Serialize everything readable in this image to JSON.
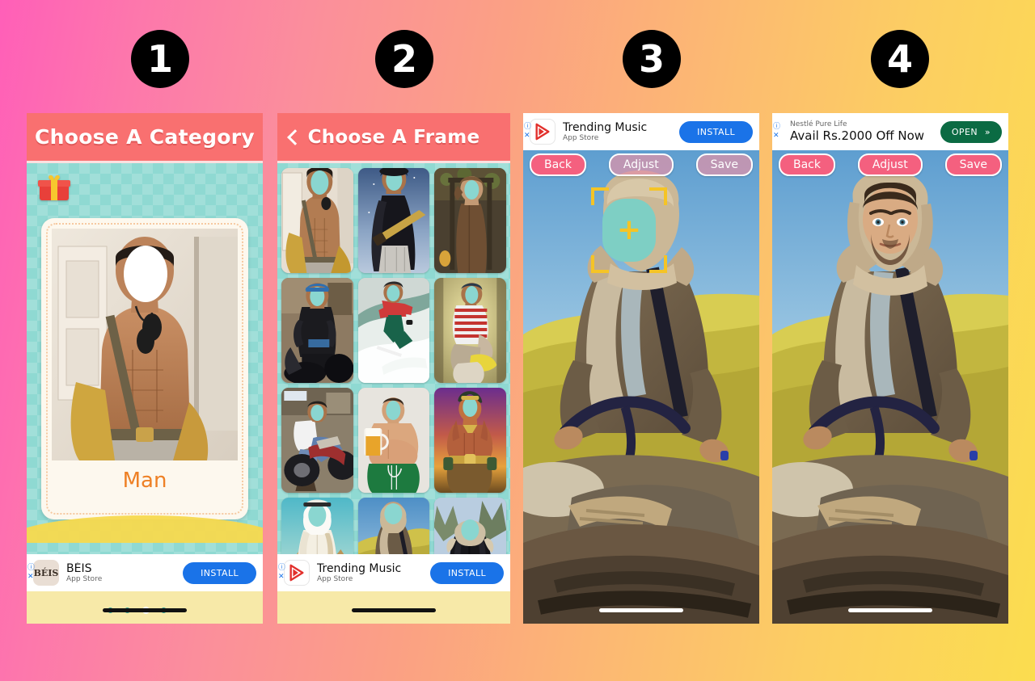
{
  "steps": [
    {
      "number": "1"
    },
    {
      "number": "2"
    },
    {
      "number": "3"
    },
    {
      "number": "4"
    }
  ],
  "colors": {
    "background_start": "#ff5fb8",
    "background_end": "#fbdd4f",
    "appbar": "#f97070",
    "teal": "#8fd9d2",
    "pill": "#f4607f",
    "accent_orange": "#ee8025",
    "install_blue": "#1a73e8",
    "open_green": "#0b6b43",
    "badge_black": "#000000",
    "face_placeholder": "#7ecfc4",
    "bracket_yellow": "#f5c426"
  },
  "screen1": {
    "title": "Choose A Category",
    "gift_icon": "gift-icon",
    "category_label": "Man",
    "pager": {
      "count": 5,
      "active_index": 2
    },
    "ad": {
      "icon_text": "BÉIS",
      "title": "BÉIS",
      "subtitle": "App Store",
      "cta": "INSTALL",
      "info_mark": "ⓘ",
      "close_mark": "✕"
    }
  },
  "screen2": {
    "title": "Choose A Frame",
    "back_icon": "chevron-left-icon",
    "frames": [
      {
        "name": "shirtless-model-frame"
      },
      {
        "name": "rockstar-guitarist-frame"
      },
      {
        "name": "monk-robe-frame"
      },
      {
        "name": "biker-leather-frame"
      },
      {
        "name": "surfer-wave-frame"
      },
      {
        "name": "sailor-striped-frame"
      },
      {
        "name": "motorcycle-rider-frame"
      },
      {
        "name": "beer-belly-frame"
      },
      {
        "name": "barbarian-warrior-frame"
      },
      {
        "name": "arab-thobe-frame"
      },
      {
        "name": "desert-camel-rider-frame"
      },
      {
        "name": "winter-fur-jacket-frame"
      }
    ],
    "ad": {
      "icon_text": "play-store-icon",
      "title": "Trending Music",
      "subtitle": "App Store",
      "cta": "INSTALL",
      "info_mark": "ⓘ",
      "close_mark": "✕"
    }
  },
  "screen3": {
    "buttons": {
      "back": "Back",
      "adjust": "Adjust",
      "save": "Save"
    },
    "buttons_state": {
      "back": "active",
      "adjust": "disabled",
      "save": "disabled"
    },
    "face_placeholder": {
      "icon": "plus-icon",
      "hint": "add-face-target"
    },
    "ad": {
      "icon_text": "play-store-icon",
      "title": "Trending Music",
      "subtitle": "App Store",
      "cta": "INSTALL",
      "info_mark": "ⓘ",
      "close_mark": "✕"
    }
  },
  "screen4": {
    "buttons": {
      "back": "Back",
      "adjust": "Adjust",
      "save": "Save"
    },
    "buttons_state": {
      "back": "active",
      "adjust": "active",
      "save": "active"
    },
    "ad": {
      "brand": "Nestlé Pure Life",
      "title": "Avail Rs.2000 Off Now",
      "cta": "OPEN",
      "cta_arrow": "»",
      "info_mark": "ⓘ",
      "close_mark": "✕"
    }
  }
}
